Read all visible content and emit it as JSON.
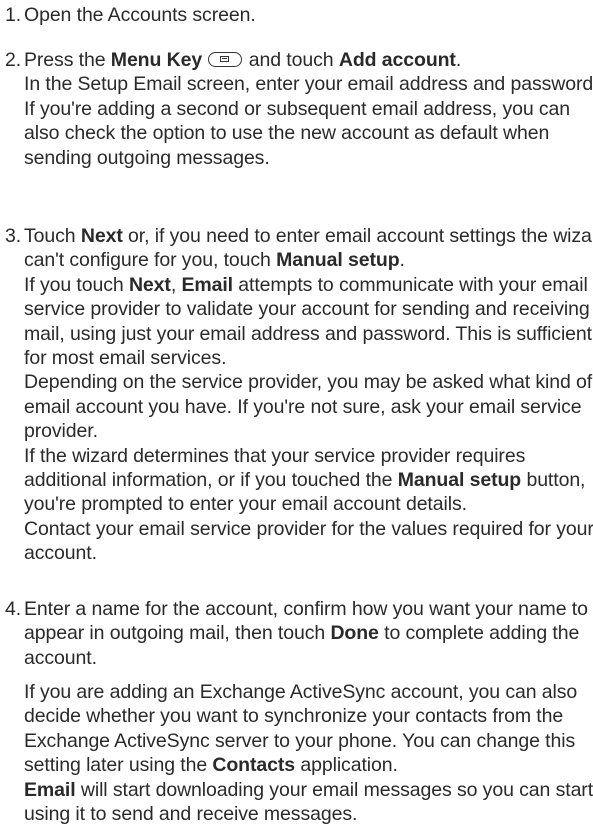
{
  "steps": [
    {
      "number": "1.",
      "text": "Open the Accounts screen."
    },
    {
      "number": "2.",
      "pre": "Press the ",
      "menu_key": "Menu Key",
      "mid": " and touch ",
      "add_account": "Add account",
      "end": ".",
      "para1": "In the Setup Email screen, enter your email address and password.",
      "para2": "If you're adding a second or subsequent email address, you can also check the option to use the new account as default when sending outgoing messages."
    },
    {
      "number": "3.",
      "pre": "Touch ",
      "next": "Next",
      "mid": " or, if you need to enter email account settings the wizard can't configure for you, touch ",
      "manual_setup": "Manual setup",
      "end": ".",
      "para1_pre": "If you touch ",
      "para1_next": "Next",
      "para1_comma": ", ",
      "para1_email": "Email",
      "para1_rest": " attempts to communicate with your email service provider to validate your account for sending and receiving mail, using just your email address and password. This is sufficient for most email services.",
      "para2": "Depending on the service provider, you may be asked what kind of email account you have. If you're not sure, ask your email service provider.",
      "para3_pre": "If the wizard determines that your service provider requires additional information, or if you touched the ",
      "para3_manual": "Manual setup",
      "para3_rest": " button, you're prompted to enter your email account details.",
      "para4": "Contact your email service provider for the values required for your account."
    },
    {
      "number": "4.",
      "pre": "Enter a name for the account, confirm how you want your name to appear in outgoing mail, then touch ",
      "done": "Done",
      "rest": " to complete adding the account.",
      "note_pre": "If you are adding an Exchange ActiveSync account, you can also decide whether you want to synchronize your contacts from the Exchange ActiveSync server to your phone. You can change this setting later using the ",
      "note_contacts": "Contacts",
      "note_mid": " application.",
      "note_email": "Email",
      "note_rest": " will start downloading your email messages so you can start using it to send and receive messages."
    }
  ],
  "icons": {
    "menu_key": "menu-key-icon"
  }
}
